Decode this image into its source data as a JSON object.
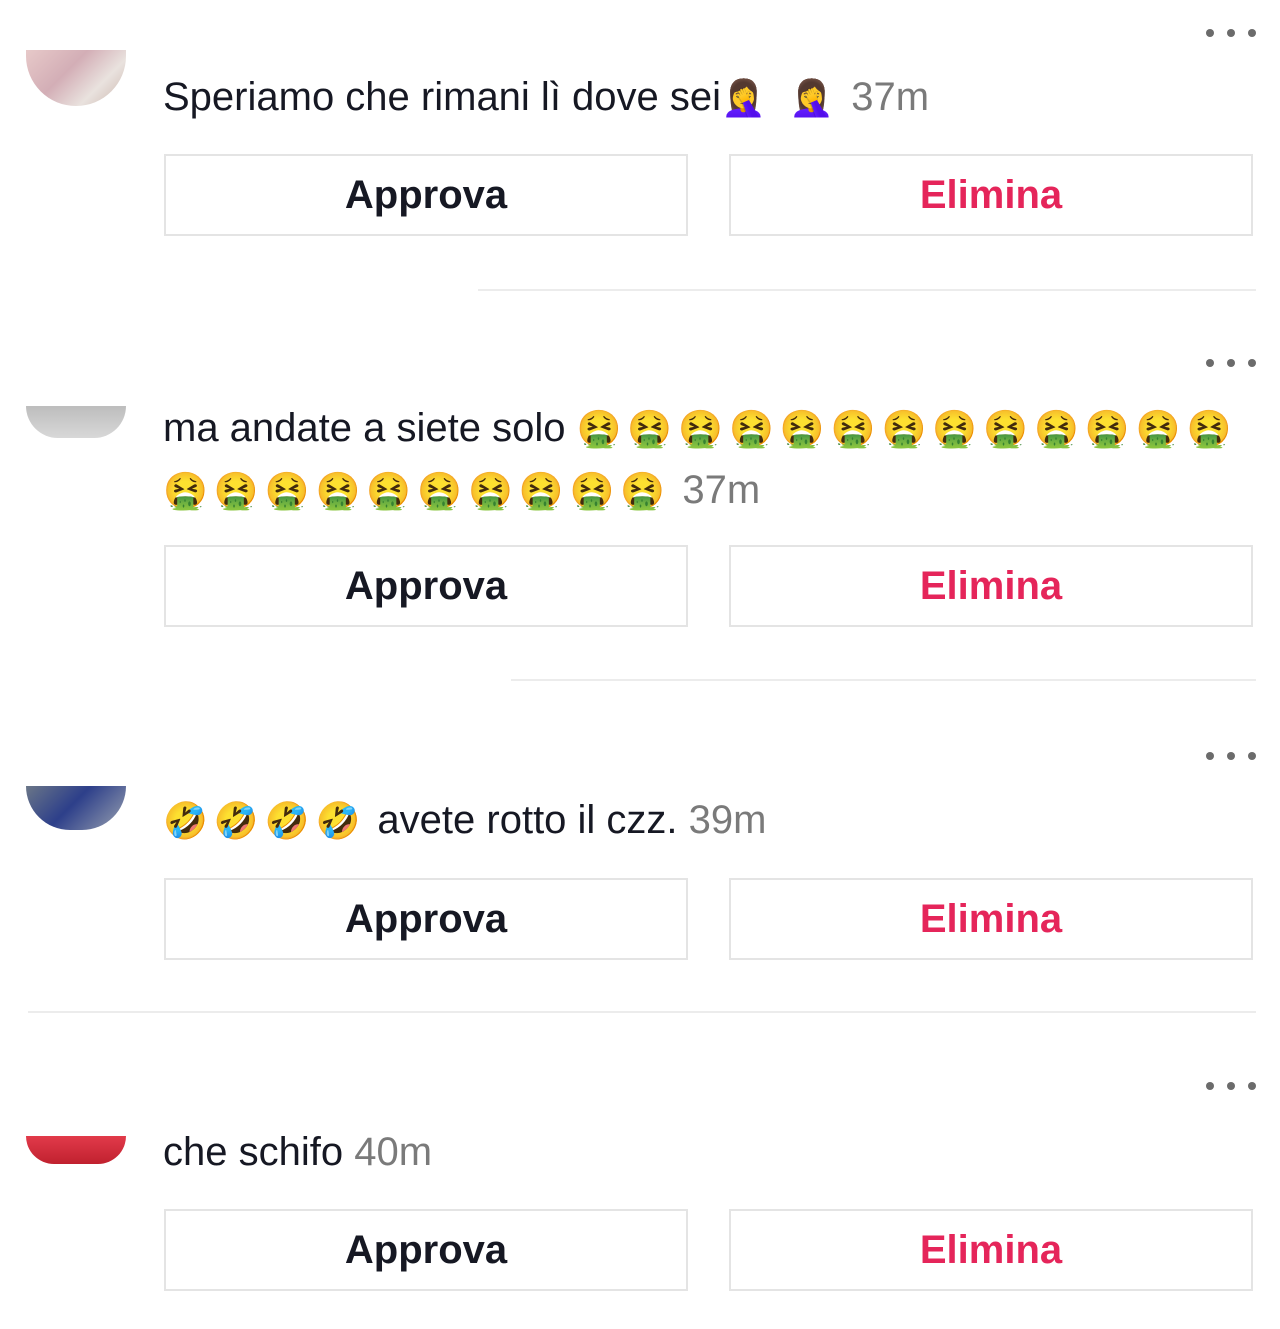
{
  "actions": {
    "approve": "Approva",
    "delete": "Elimina"
  },
  "comments": [
    {
      "text": "Speriamo che rimani lì dove sei",
      "emoji": "🤦‍♀️ 🤦‍♀️",
      "time": "37m"
    },
    {
      "text": "ma andate a siete solo",
      "emoji": "🤮🤮🤮🤮🤮🤮🤮🤮🤮🤮🤮🤮🤮🤮🤮🤮🤮🤮🤮🤮🤮🤮🤮",
      "time": "37m"
    },
    {
      "emoji": "🤣🤣🤣🤣",
      "text": "avete rotto il czz.",
      "time": "39m"
    },
    {
      "text": "che schifo",
      "time": "40m"
    }
  ],
  "colors": {
    "delete": "#e5255a",
    "time": "#7a7a7a",
    "border": "#e4e4e4"
  }
}
